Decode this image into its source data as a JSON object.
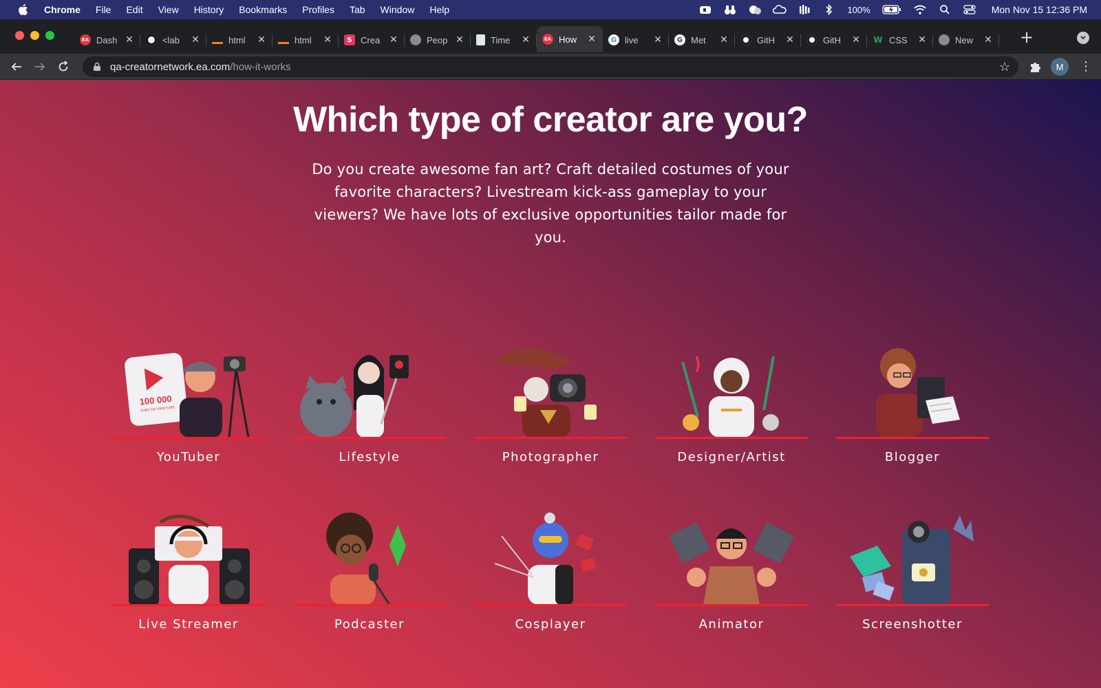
{
  "menubar": {
    "app_name": "Chrome",
    "items": [
      "File",
      "Edit",
      "View",
      "History",
      "Bookmarks",
      "Profiles",
      "Tab",
      "Window",
      "Help"
    ],
    "battery": "100%",
    "clock": "Mon Nov 15  12:36 PM"
  },
  "tabs": [
    {
      "title": "Dash",
      "favicon": "ea-icon",
      "color": "#e8343e",
      "active": false
    },
    {
      "title": "<lab",
      "favicon": "panther-icon",
      "color": "#111111",
      "active": false
    },
    {
      "title": "html",
      "favicon": "stackoverflow-icon",
      "color": "#f48024",
      "active": false
    },
    {
      "title": "html",
      "favicon": "stackoverflow-icon",
      "color": "#f48024",
      "active": false
    },
    {
      "title": "Crea",
      "favicon": "s-logo-icon",
      "color": "#e8345e",
      "active": false
    },
    {
      "title": "Peop",
      "favicon": "globe-icon",
      "color": "#8a8a8a",
      "active": false
    },
    {
      "title": "Time",
      "favicon": "doc-icon",
      "color": "#dfe6f0",
      "active": false
    },
    {
      "title": "How",
      "favicon": "ea-icon",
      "color": "#e8343e",
      "active": true
    },
    {
      "title": "live",
      "favicon": "google-icon",
      "color": "#4285f4",
      "active": false
    },
    {
      "title": "Met",
      "favicon": "g-bold-icon",
      "color": "#1f3b8f",
      "active": false
    },
    {
      "title": "GitH",
      "favicon": "github-icon",
      "color": "#ffffff",
      "active": false
    },
    {
      "title": "GitH",
      "favicon": "github-icon",
      "color": "#ffffff",
      "active": false
    },
    {
      "title": "CSS",
      "favicon": "w-icon",
      "color": "#1da462",
      "active": false
    },
    {
      "title": "New",
      "favicon": "chrome-icon",
      "color": "#8a8a8a",
      "active": false
    }
  ],
  "omnibox": {
    "host": "qa-creatornetwork.ea.com",
    "path": "/how-it-works"
  },
  "profile_initial": "M",
  "page": {
    "title": "Which type of creator are you?",
    "intro": "Do you create awesome fan art? Craft detailed costumes of your favorite characters? Livestream kick-ass gameplay to your viewers? We have lots of exclusive opportunities tailor made for you.",
    "creators": [
      {
        "label": "YouTuber",
        "icon": "youtuber-illustration"
      },
      {
        "label": "Lifestyle",
        "icon": "lifestyle-illustration"
      },
      {
        "label": "Photographer",
        "icon": "photographer-illustration"
      },
      {
        "label": "Designer/Artist",
        "icon": "designer-artist-illustration"
      },
      {
        "label": "Blogger",
        "icon": "blogger-illustration"
      },
      {
        "label": "Live Streamer",
        "icon": "live-streamer-illustration"
      },
      {
        "label": "Podcaster",
        "icon": "podcaster-illustration"
      },
      {
        "label": "Cosplayer",
        "icon": "cosplayer-illustration"
      },
      {
        "label": "Animator",
        "icon": "animator-illustration"
      },
      {
        "label": "Screenshotter",
        "icon": "screenshotter-illustration"
      }
    ],
    "youtuber_badge": {
      "count": "100 000",
      "caption": "SUBS ON VIEWTUBE"
    }
  },
  "colors": {
    "accent_underline": "#f0202e",
    "gradient_start": "#ee3f4a",
    "gradient_end": "#1b1450"
  }
}
